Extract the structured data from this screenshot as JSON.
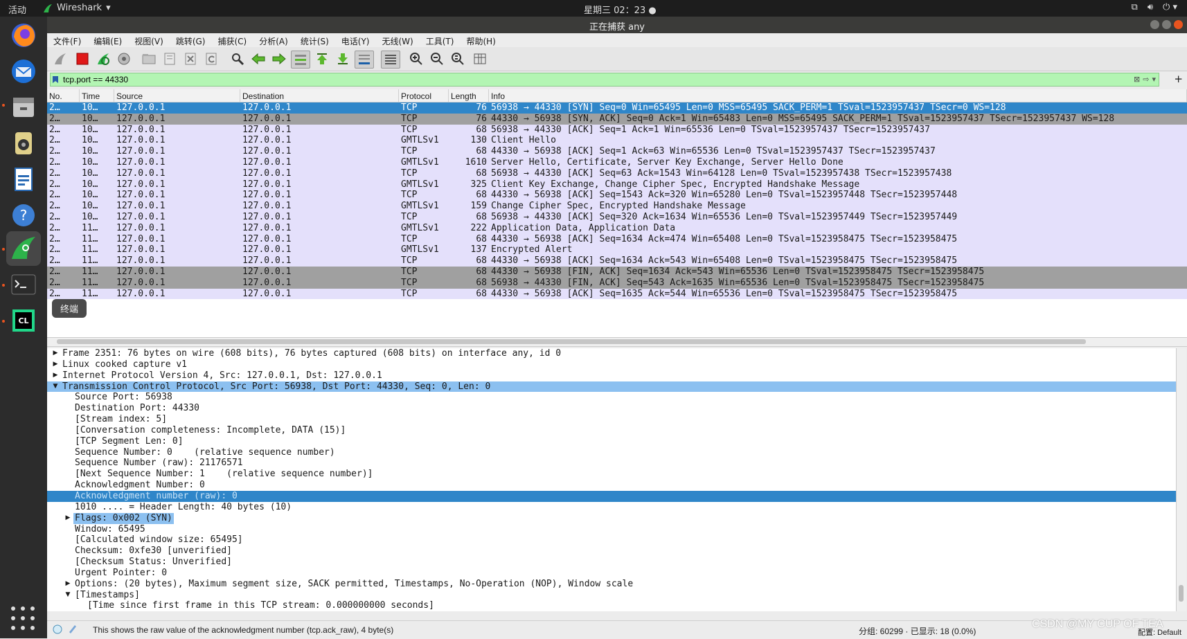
{
  "topbar": {
    "activities": "活动",
    "app_name": "Wireshark",
    "clock": "星期三 02：23"
  },
  "window": {
    "title": "正在捕获 any"
  },
  "menu": [
    "文件(F)",
    "编辑(E)",
    "视图(V)",
    "跳转(G)",
    "捕获(C)",
    "分析(A)",
    "统计(S)",
    "电话(Y)",
    "无线(W)",
    "工具(T)",
    "帮助(H)"
  ],
  "toolbar": {
    "icons": [
      "shark-fin-start-icon",
      "stop-capture-icon",
      "restart-capture-icon",
      "capture-options-icon",
      "open-file-icon",
      "save-file-icon",
      "close-file-icon",
      "reload-icon",
      "find-packet-icon",
      "go-back-icon",
      "go-forward-icon",
      "go-to-packet-icon",
      "first-packet-icon",
      "last-packet-icon",
      "autoscroll-icon",
      "colorize-icon",
      "zoom-in-icon",
      "zoom-out-icon",
      "normal-size-icon",
      "resize-columns-icon"
    ]
  },
  "filter": {
    "value": "tcp.port == 44330",
    "add": "+"
  },
  "columns": [
    "No.",
    "Time",
    "Source",
    "Destination",
    "Protocol",
    "Length",
    "Info"
  ],
  "packets": [
    {
      "no": "2…",
      "time": "10…",
      "src": "127.0.0.1",
      "dst": "127.0.0.1",
      "proto": "TCP",
      "len": "76",
      "info": "56938 → 44330 [SYN] Seq=0 Win=65495 Len=0 MSS=65495 SACK_PERM=1 TSval=1523957437 TSecr=0 WS=128",
      "style": "sel"
    },
    {
      "no": "2…",
      "time": "10…",
      "src": "127.0.0.1",
      "dst": "127.0.0.1",
      "proto": "TCP",
      "len": "76",
      "info": "44330 → 56938 [SYN, ACK] Seq=0 Ack=1 Win=65483 Len=0 MSS=65495 SACK_PERM=1 TSval=1523957437 TSecr=1523957437 WS=128",
      "style": "tcp-syn"
    },
    {
      "no": "2…",
      "time": "10…",
      "src": "127.0.0.1",
      "dst": "127.0.0.1",
      "proto": "TCP",
      "len": "68",
      "info": "56938 → 44330 [ACK] Seq=1 Ack=1 Win=65536 Len=0 TSval=1523957437 TSecr=1523957437",
      "style": ""
    },
    {
      "no": "2…",
      "time": "10…",
      "src": "127.0.0.1",
      "dst": "127.0.0.1",
      "proto": "GMTLSv1",
      "len": "130",
      "info": "Client Hello",
      "style": ""
    },
    {
      "no": "2…",
      "time": "10…",
      "src": "127.0.0.1",
      "dst": "127.0.0.1",
      "proto": "TCP",
      "len": "68",
      "info": "44330 → 56938 [ACK] Seq=1 Ack=63 Win=65536 Len=0 TSval=1523957437 TSecr=1523957437",
      "style": ""
    },
    {
      "no": "2…",
      "time": "10…",
      "src": "127.0.0.1",
      "dst": "127.0.0.1",
      "proto": "GMTLSv1",
      "len": "1610",
      "info": "Server Hello, Certificate, Server Key Exchange, Server Hello Done",
      "style": ""
    },
    {
      "no": "2…",
      "time": "10…",
      "src": "127.0.0.1",
      "dst": "127.0.0.1",
      "proto": "TCP",
      "len": "68",
      "info": "56938 → 44330 [ACK] Seq=63 Ack=1543 Win=64128 Len=0 TSval=1523957438 TSecr=1523957438",
      "style": ""
    },
    {
      "no": "2…",
      "time": "10…",
      "src": "127.0.0.1",
      "dst": "127.0.0.1",
      "proto": "GMTLSv1",
      "len": "325",
      "info": "Client Key Exchange, Change Cipher Spec, Encrypted Handshake Message",
      "style": ""
    },
    {
      "no": "2…",
      "time": "10…",
      "src": "127.0.0.1",
      "dst": "127.0.0.1",
      "proto": "TCP",
      "len": "68",
      "info": "44330 → 56938 [ACK] Seq=1543 Ack=320 Win=65280 Len=0 TSval=1523957448 TSecr=1523957448",
      "style": ""
    },
    {
      "no": "2…",
      "time": "10…",
      "src": "127.0.0.1",
      "dst": "127.0.0.1",
      "proto": "GMTLSv1",
      "len": "159",
      "info": "Change Cipher Spec, Encrypted Handshake Message",
      "style": ""
    },
    {
      "no": "2…",
      "time": "10…",
      "src": "127.0.0.1",
      "dst": "127.0.0.1",
      "proto": "TCP",
      "len": "68",
      "info": "56938 → 44330 [ACK] Seq=320 Ack=1634 Win=65536 Len=0 TSval=1523957449 TSecr=1523957449",
      "style": ""
    },
    {
      "no": "2…",
      "time": "11…",
      "src": "127.0.0.1",
      "dst": "127.0.0.1",
      "proto": "GMTLSv1",
      "len": "222",
      "info": "Application Data, Application Data",
      "style": ""
    },
    {
      "no": "2…",
      "time": "11…",
      "src": "127.0.0.1",
      "dst": "127.0.0.1",
      "proto": "TCP",
      "len": "68",
      "info": "44330 → 56938 [ACK] Seq=1634 Ack=474 Win=65408 Len=0 TSval=1523958475 TSecr=1523958475",
      "style": ""
    },
    {
      "no": "2…",
      "time": "11…",
      "src": "127.0.0.1",
      "dst": "127.0.0.1",
      "proto": "GMTLSv1",
      "len": "137",
      "info": "Encrypted Alert",
      "style": ""
    },
    {
      "no": "2…",
      "time": "11…",
      "src": "127.0.0.1",
      "dst": "127.0.0.1",
      "proto": "TCP",
      "len": "68",
      "info": "44330 → 56938 [ACK] Seq=1634 Ack=543 Win=65408 Len=0 TSval=1523958475 TSecr=1523958475",
      "style": ""
    },
    {
      "no": "2…",
      "time": "11…",
      "src": "127.0.0.1",
      "dst": "127.0.0.1",
      "proto": "TCP",
      "len": "68",
      "info": "44330 → 56938 [FIN, ACK] Seq=1634 Ack=543 Win=65536 Len=0 TSval=1523958475 TSecr=1523958475",
      "style": "tcp-syn"
    },
    {
      "no": "2…",
      "time": "11…",
      "src": "127.0.0.1",
      "dst": "127.0.0.1",
      "proto": "TCP",
      "len": "68",
      "info": "56938 → 44330 [FIN, ACK] Seq=543 Ack=1635 Win=65536 Len=0 TSval=1523958475 TSecr=1523958475",
      "style": "tcp-syn"
    },
    {
      "no": "2…",
      "time": "11…",
      "src": "127.0.0.1",
      "dst": "127.0.0.1",
      "proto": "TCP",
      "len": "68",
      "info": "44330 → 56938 [ACK] Seq=1635 Ack=544 Win=65536 Len=0 TSval=1523958475 TSecr=1523958475",
      "style": ""
    }
  ],
  "tooltip": "终端",
  "details": [
    {
      "text": "Frame 2351: 76 bytes on wire (608 bits), 76 bytes captured (608 bits) on interface any, id 0",
      "level": 0,
      "arrow": "right",
      "style": ""
    },
    {
      "text": "Linux cooked capture v1",
      "level": 0,
      "arrow": "right",
      "style": ""
    },
    {
      "text": "Internet Protocol Version 4, Src: 127.0.0.1, Dst: 127.0.0.1",
      "level": 0,
      "arrow": "right",
      "style": ""
    },
    {
      "text": "Transmission Control Protocol, Src Port: 56938, Dst Port: 44330, Seq: 0, Len: 0",
      "level": 0,
      "arrow": "down",
      "style": "hl-tcp"
    },
    {
      "text": "Source Port: 56938",
      "level": 1,
      "arrow": "",
      "style": ""
    },
    {
      "text": "Destination Port: 44330",
      "level": 1,
      "arrow": "",
      "style": ""
    },
    {
      "text": "[Stream index: 5]",
      "level": 1,
      "arrow": "",
      "style": ""
    },
    {
      "text": "[Conversation completeness: Incomplete, DATA (15)]",
      "level": 1,
      "arrow": "",
      "style": ""
    },
    {
      "text": "[TCP Segment Len: 0]",
      "level": 1,
      "arrow": "",
      "style": ""
    },
    {
      "text": "Sequence Number: 0    (relative sequence number)",
      "level": 1,
      "arrow": "",
      "style": ""
    },
    {
      "text": "Sequence Number (raw): 21176571",
      "level": 1,
      "arrow": "",
      "style": ""
    },
    {
      "text": "[Next Sequence Number: 1    (relative sequence number)]",
      "level": 1,
      "arrow": "",
      "style": ""
    },
    {
      "text": "Acknowledgment Number: 0",
      "level": 1,
      "arrow": "",
      "style": ""
    },
    {
      "text": "Acknowledgment number (raw): 0",
      "level": 1,
      "arrow": "",
      "style": "sel-strong"
    },
    {
      "text": "1010 .... = Header Length: 40 bytes (10)",
      "level": 1,
      "arrow": "",
      "style": ""
    },
    {
      "text": "Flags: 0x002 (SYN)",
      "level": 1,
      "arrow": "right",
      "style": "sel-light"
    },
    {
      "text": "Window: 65495",
      "level": 1,
      "arrow": "",
      "style": ""
    },
    {
      "text": "[Calculated window size: 65495]",
      "level": 1,
      "arrow": "",
      "style": ""
    },
    {
      "text": "Checksum: 0xfe30 [unverified]",
      "level": 1,
      "arrow": "",
      "style": ""
    },
    {
      "text": "[Checksum Status: Unverified]",
      "level": 1,
      "arrow": "",
      "style": ""
    },
    {
      "text": "Urgent Pointer: 0",
      "level": 1,
      "arrow": "",
      "style": ""
    },
    {
      "text": "Options: (20 bytes), Maximum segment size, SACK permitted, Timestamps, No-Operation (NOP), Window scale",
      "level": 1,
      "arrow": "right",
      "style": ""
    },
    {
      "text": "[Timestamps]",
      "level": 1,
      "arrow": "down",
      "style": ""
    },
    {
      "text": "[Time since first frame in this TCP stream: 0.000000000 seconds]",
      "level": 2,
      "arrow": "",
      "style": ""
    }
  ],
  "status": {
    "message": "This shows the raw value of the acknowledgment number (tcp.ack_raw), 4 byte(s)",
    "stats": "分组: 60299 · 已显示: 18 (0.0%)",
    "profile": "配置: Default"
  },
  "watermark": "CSDN @MY CUP OF TEA",
  "colors": {
    "selected": "#2f86c9",
    "tcp_flag_row": "#a0a0a0",
    "normal_row": "#e4e0fb",
    "filter_ok": "#b3f5b3"
  }
}
